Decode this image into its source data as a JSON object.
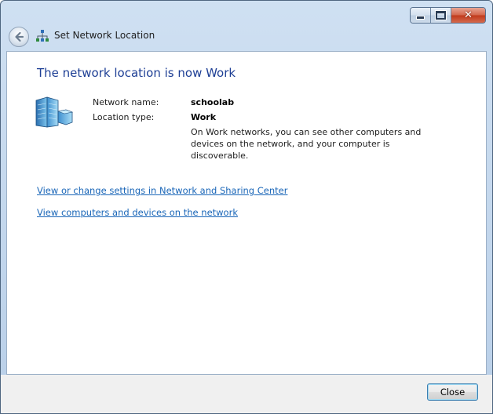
{
  "window": {
    "title": "Set Network Location",
    "caption_buttons": {
      "minimize_icon": "minimize-icon",
      "maximize_icon": "maximize-icon",
      "close_glyph": "✕"
    }
  },
  "content": {
    "heading": "The network location is now Work",
    "network_name_label": "Network name:",
    "network_name_value": "schoolab",
    "location_type_label": "Location type:",
    "location_type_value": "Work",
    "description": "On Work networks, you can see other computers and devices on the network, and your computer is discoverable.",
    "links": [
      "View or change settings in Network and Sharing Center",
      "View computers and devices on the network"
    ]
  },
  "footer": {
    "close_label": "Close"
  },
  "colors": {
    "heading": "#1e3f95",
    "link": "#1a66b8",
    "frame": "#b9cfe8",
    "footer": "#f0f0f0"
  }
}
